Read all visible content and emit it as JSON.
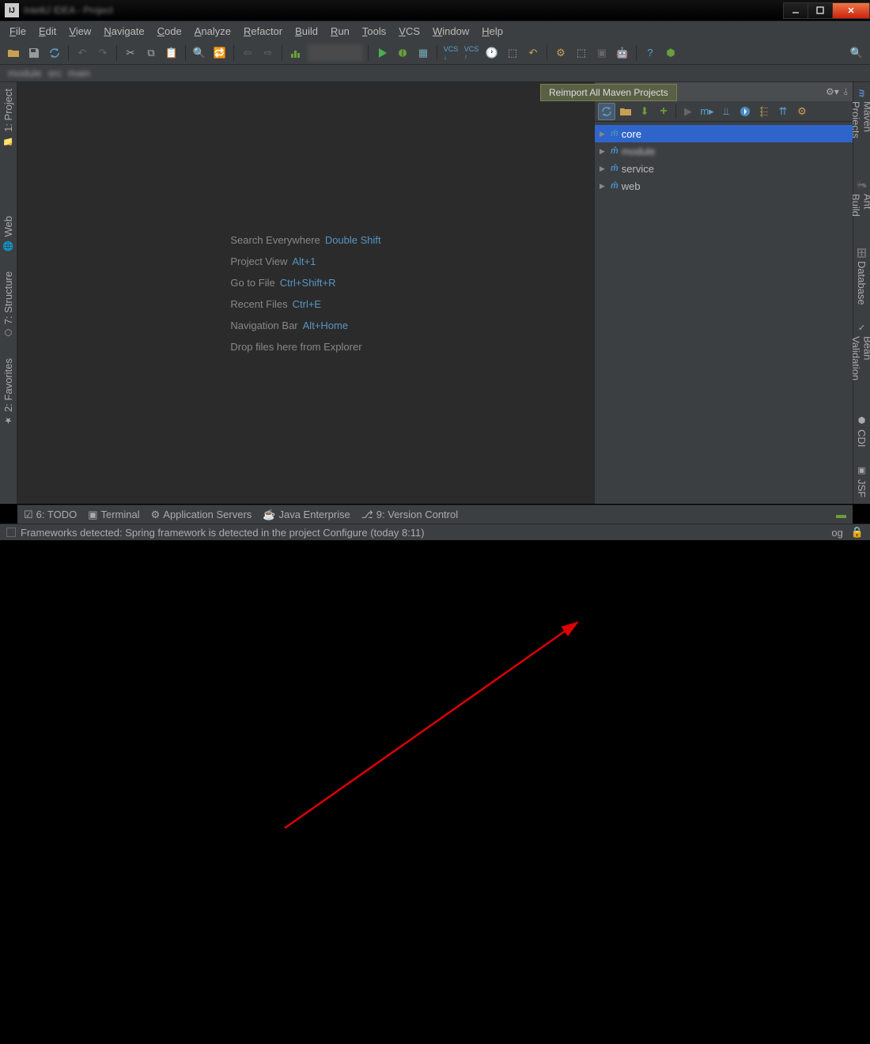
{
  "titlebar": {
    "logo": "IJ",
    "title": "IntelliJ IDEA - Project"
  },
  "menu": [
    "File",
    "Edit",
    "View",
    "Navigate",
    "Code",
    "Analyze",
    "Refactor",
    "Build",
    "Run",
    "Tools",
    "VCS",
    "Window",
    "Help"
  ],
  "left_tabs": [
    {
      "label": "1: Project",
      "icon": "📁"
    },
    {
      "label": "Web",
      "icon": "🌐"
    },
    {
      "label": "7: Structure",
      "icon": "⬡"
    },
    {
      "label": "2: Favorites",
      "icon": "★"
    }
  ],
  "right_tabs": [
    {
      "label": "Maven Projects",
      "icon": "m"
    },
    {
      "label": "Ant Build",
      "icon": "🐜"
    },
    {
      "label": "Database",
      "icon": "🗄"
    },
    {
      "label": "Bean Validation",
      "icon": "✓"
    },
    {
      "label": "CDI",
      "icon": "⬢"
    },
    {
      "label": "JSF",
      "icon": "▣"
    }
  ],
  "hints": [
    {
      "label": "Search Everywhere",
      "key": "Double Shift"
    },
    {
      "label": "Project View",
      "key": "Alt+1"
    },
    {
      "label": "Go to File",
      "key": "Ctrl+Shift+R"
    },
    {
      "label": "Recent Files",
      "key": "Ctrl+E"
    },
    {
      "label": "Navigation Bar",
      "key": "Alt+Home"
    },
    {
      "label": "Drop files here from Explorer",
      "key": ""
    }
  ],
  "maven": {
    "tooltip": "Reimport All Maven Projects",
    "tree": [
      {
        "label": "core",
        "selected": true
      },
      {
        "label": "module",
        "blurred": true
      },
      {
        "label": "service"
      },
      {
        "label": "web"
      }
    ]
  },
  "bottom_tabs": [
    {
      "icon": "☑",
      "label": "6: TODO"
    },
    {
      "icon": "▣",
      "label": "Terminal"
    },
    {
      "icon": "⚙",
      "label": "Application Servers"
    },
    {
      "icon": "☕",
      "label": "Java Enterprise"
    },
    {
      "icon": "⎇",
      "label": "9: Version Control"
    }
  ],
  "status": {
    "message": "Frameworks detected: Spring framework is detected in the project Configure (today 8:11)",
    "right": "og"
  }
}
